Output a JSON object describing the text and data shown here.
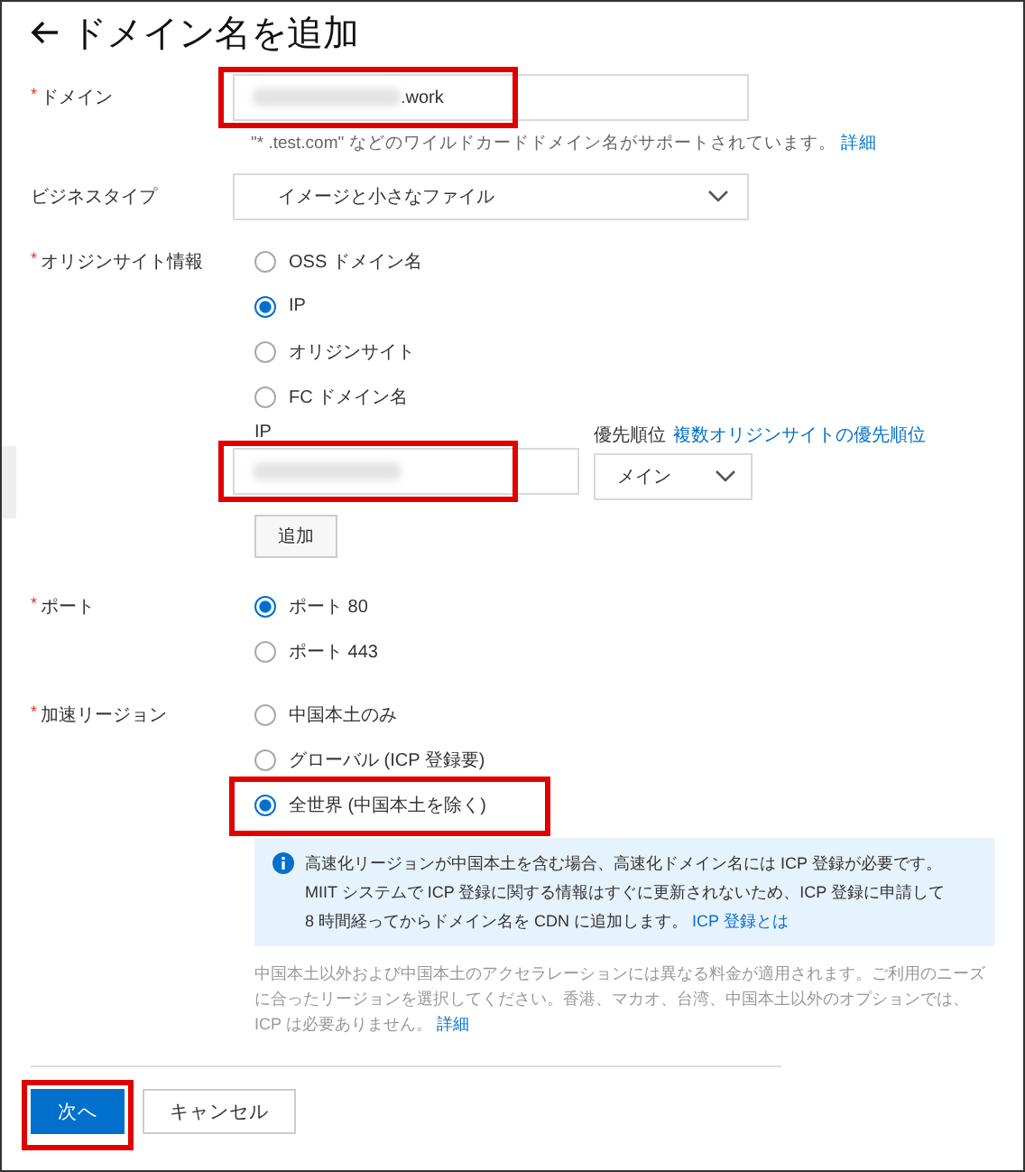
{
  "title": "ドメイン名を追加",
  "domain": {
    "label": "ドメイン",
    "required_mark": "*",
    "value": ".work",
    "redacted": true,
    "highlighted": true,
    "hint": "\"* .test.com\" などのワイルドカードドメイン名がサポートされています。",
    "hint_link": "詳細"
  },
  "business_type": {
    "label": "ビジネスタイプ",
    "value": "イメージと小さなファイル"
  },
  "origin": {
    "label": "オリジンサイト情報",
    "required_mark": "*",
    "options": [
      {
        "label": "OSS ドメイン名",
        "selected": false,
        "highlighted": false
      },
      {
        "label": "IP",
        "selected": true,
        "highlighted": false
      },
      {
        "label": "オリジンサイト",
        "selected": false,
        "highlighted": false
      },
      {
        "label": "FC ドメイン名",
        "selected": false,
        "highlighted": false
      }
    ],
    "ip_label": "IP",
    "ip_redacted": true,
    "ip_highlighted": true,
    "priority_label": "優先順位",
    "priority_link": "複数オリジンサイトの優先順位",
    "priority_value": "メイン",
    "add_button": "追加"
  },
  "port": {
    "label": "ポート",
    "required_mark": "*",
    "options": [
      {
        "label": "ポート 80",
        "selected": true,
        "highlighted": false
      },
      {
        "label": "ポート 443",
        "selected": false,
        "highlighted": false
      }
    ]
  },
  "region": {
    "label": "加速リージョン",
    "required_mark": "*",
    "options": [
      {
        "label": "中国本土のみ",
        "selected": false,
        "highlighted": false
      },
      {
        "label": "グローバル (ICP 登録要)",
        "selected": false,
        "highlighted": false
      },
      {
        "label": "全世界 (中国本土を除く)",
        "selected": true,
        "highlighted": true
      }
    ],
    "info_lines": [
      "高速化リージョンが中国本土を含む場合、高速化ドメイン名には ICP 登録が必要です。",
      "MIIT システムで ICP 登録に関する情報はすぐに更新されないため、ICP 登録に申請して",
      "8 時間経ってからドメイン名を CDN に追加します。"
    ],
    "info_link": "ICP 登録とは",
    "note": "中国本土以外および中国本土のアクセラレーションには異なる料金が適用されます。ご利用のニーズに合ったリージョンを選択してください。香港、マカオ、台湾、中国本土以外のオプションでは、ICP は必要ありません。",
    "note_link": "詳細"
  },
  "buttons": [
    {
      "label": "次へ",
      "kind": "primary",
      "highlighted": true
    },
    {
      "label": "キャンセル",
      "kind": "secondary",
      "highlighted": false
    }
  ]
}
